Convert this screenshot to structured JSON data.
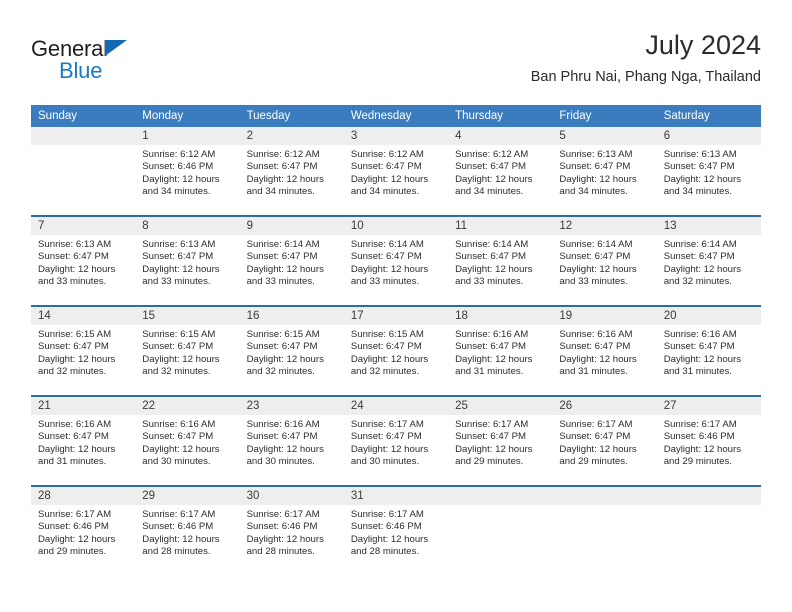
{
  "brand": {
    "name_part1": "General",
    "name_part2": "Blue",
    "triangle_color": "#1268b3",
    "blue_color": "#1b7ac4"
  },
  "header": {
    "title": "July 2024",
    "subtitle": "Ban Phru Nai, Phang Nga, Thailand"
  },
  "theme": {
    "header_bar_color": "#3a7cbe",
    "row_divider_color": "#2e6da4",
    "daynum_strip_color": "#eeeeee"
  },
  "weekdays": [
    "Sunday",
    "Monday",
    "Tuesday",
    "Wednesday",
    "Thursday",
    "Friday",
    "Saturday"
  ],
  "labels": {
    "sunrise_prefix": "Sunrise: ",
    "sunset_prefix": "Sunset: ",
    "daylight_prefix": "Daylight: "
  },
  "weeks": [
    [
      {
        "day": "",
        "sunrise": "",
        "sunset": "",
        "daylight_l1": "",
        "daylight_l2": ""
      },
      {
        "day": "1",
        "sunrise": "Sunrise: 6:12 AM",
        "sunset": "Sunset: 6:46 PM",
        "daylight_l1": "Daylight: 12 hours",
        "daylight_l2": "and 34 minutes."
      },
      {
        "day": "2",
        "sunrise": "Sunrise: 6:12 AM",
        "sunset": "Sunset: 6:47 PM",
        "daylight_l1": "Daylight: 12 hours",
        "daylight_l2": "and 34 minutes."
      },
      {
        "day": "3",
        "sunrise": "Sunrise: 6:12 AM",
        "sunset": "Sunset: 6:47 PM",
        "daylight_l1": "Daylight: 12 hours",
        "daylight_l2": "and 34 minutes."
      },
      {
        "day": "4",
        "sunrise": "Sunrise: 6:12 AM",
        "sunset": "Sunset: 6:47 PM",
        "daylight_l1": "Daylight: 12 hours",
        "daylight_l2": "and 34 minutes."
      },
      {
        "day": "5",
        "sunrise": "Sunrise: 6:13 AM",
        "sunset": "Sunset: 6:47 PM",
        "daylight_l1": "Daylight: 12 hours",
        "daylight_l2": "and 34 minutes."
      },
      {
        "day": "6",
        "sunrise": "Sunrise: 6:13 AM",
        "sunset": "Sunset: 6:47 PM",
        "daylight_l1": "Daylight: 12 hours",
        "daylight_l2": "and 34 minutes."
      }
    ],
    [
      {
        "day": "7",
        "sunrise": "Sunrise: 6:13 AM",
        "sunset": "Sunset: 6:47 PM",
        "daylight_l1": "Daylight: 12 hours",
        "daylight_l2": "and 33 minutes."
      },
      {
        "day": "8",
        "sunrise": "Sunrise: 6:13 AM",
        "sunset": "Sunset: 6:47 PM",
        "daylight_l1": "Daylight: 12 hours",
        "daylight_l2": "and 33 minutes."
      },
      {
        "day": "9",
        "sunrise": "Sunrise: 6:14 AM",
        "sunset": "Sunset: 6:47 PM",
        "daylight_l1": "Daylight: 12 hours",
        "daylight_l2": "and 33 minutes."
      },
      {
        "day": "10",
        "sunrise": "Sunrise: 6:14 AM",
        "sunset": "Sunset: 6:47 PM",
        "daylight_l1": "Daylight: 12 hours",
        "daylight_l2": "and 33 minutes."
      },
      {
        "day": "11",
        "sunrise": "Sunrise: 6:14 AM",
        "sunset": "Sunset: 6:47 PM",
        "daylight_l1": "Daylight: 12 hours",
        "daylight_l2": "and 33 minutes."
      },
      {
        "day": "12",
        "sunrise": "Sunrise: 6:14 AM",
        "sunset": "Sunset: 6:47 PM",
        "daylight_l1": "Daylight: 12 hours",
        "daylight_l2": "and 33 minutes."
      },
      {
        "day": "13",
        "sunrise": "Sunrise: 6:14 AM",
        "sunset": "Sunset: 6:47 PM",
        "daylight_l1": "Daylight: 12 hours",
        "daylight_l2": "and 32 minutes."
      }
    ],
    [
      {
        "day": "14",
        "sunrise": "Sunrise: 6:15 AM",
        "sunset": "Sunset: 6:47 PM",
        "daylight_l1": "Daylight: 12 hours",
        "daylight_l2": "and 32 minutes."
      },
      {
        "day": "15",
        "sunrise": "Sunrise: 6:15 AM",
        "sunset": "Sunset: 6:47 PM",
        "daylight_l1": "Daylight: 12 hours",
        "daylight_l2": "and 32 minutes."
      },
      {
        "day": "16",
        "sunrise": "Sunrise: 6:15 AM",
        "sunset": "Sunset: 6:47 PM",
        "daylight_l1": "Daylight: 12 hours",
        "daylight_l2": "and 32 minutes."
      },
      {
        "day": "17",
        "sunrise": "Sunrise: 6:15 AM",
        "sunset": "Sunset: 6:47 PM",
        "daylight_l1": "Daylight: 12 hours",
        "daylight_l2": "and 32 minutes."
      },
      {
        "day": "18",
        "sunrise": "Sunrise: 6:16 AM",
        "sunset": "Sunset: 6:47 PM",
        "daylight_l1": "Daylight: 12 hours",
        "daylight_l2": "and 31 minutes."
      },
      {
        "day": "19",
        "sunrise": "Sunrise: 6:16 AM",
        "sunset": "Sunset: 6:47 PM",
        "daylight_l1": "Daylight: 12 hours",
        "daylight_l2": "and 31 minutes."
      },
      {
        "day": "20",
        "sunrise": "Sunrise: 6:16 AM",
        "sunset": "Sunset: 6:47 PM",
        "daylight_l1": "Daylight: 12 hours",
        "daylight_l2": "and 31 minutes."
      }
    ],
    [
      {
        "day": "21",
        "sunrise": "Sunrise: 6:16 AM",
        "sunset": "Sunset: 6:47 PM",
        "daylight_l1": "Daylight: 12 hours",
        "daylight_l2": "and 31 minutes."
      },
      {
        "day": "22",
        "sunrise": "Sunrise: 6:16 AM",
        "sunset": "Sunset: 6:47 PM",
        "daylight_l1": "Daylight: 12 hours",
        "daylight_l2": "and 30 minutes."
      },
      {
        "day": "23",
        "sunrise": "Sunrise: 6:16 AM",
        "sunset": "Sunset: 6:47 PM",
        "daylight_l1": "Daylight: 12 hours",
        "daylight_l2": "and 30 minutes."
      },
      {
        "day": "24",
        "sunrise": "Sunrise: 6:17 AM",
        "sunset": "Sunset: 6:47 PM",
        "daylight_l1": "Daylight: 12 hours",
        "daylight_l2": "and 30 minutes."
      },
      {
        "day": "25",
        "sunrise": "Sunrise: 6:17 AM",
        "sunset": "Sunset: 6:47 PM",
        "daylight_l1": "Daylight: 12 hours",
        "daylight_l2": "and 29 minutes."
      },
      {
        "day": "26",
        "sunrise": "Sunrise: 6:17 AM",
        "sunset": "Sunset: 6:47 PM",
        "daylight_l1": "Daylight: 12 hours",
        "daylight_l2": "and 29 minutes."
      },
      {
        "day": "27",
        "sunrise": "Sunrise: 6:17 AM",
        "sunset": "Sunset: 6:46 PM",
        "daylight_l1": "Daylight: 12 hours",
        "daylight_l2": "and 29 minutes."
      }
    ],
    [
      {
        "day": "28",
        "sunrise": "Sunrise: 6:17 AM",
        "sunset": "Sunset: 6:46 PM",
        "daylight_l1": "Daylight: 12 hours",
        "daylight_l2": "and 29 minutes."
      },
      {
        "day": "29",
        "sunrise": "Sunrise: 6:17 AM",
        "sunset": "Sunset: 6:46 PM",
        "daylight_l1": "Daylight: 12 hours",
        "daylight_l2": "and 28 minutes."
      },
      {
        "day": "30",
        "sunrise": "Sunrise: 6:17 AM",
        "sunset": "Sunset: 6:46 PM",
        "daylight_l1": "Daylight: 12 hours",
        "daylight_l2": "and 28 minutes."
      },
      {
        "day": "31",
        "sunrise": "Sunrise: 6:17 AM",
        "sunset": "Sunset: 6:46 PM",
        "daylight_l1": "Daylight: 12 hours",
        "daylight_l2": "and 28 minutes."
      },
      {
        "day": "",
        "sunrise": "",
        "sunset": "",
        "daylight_l1": "",
        "daylight_l2": ""
      },
      {
        "day": "",
        "sunrise": "",
        "sunset": "",
        "daylight_l1": "",
        "daylight_l2": ""
      },
      {
        "day": "",
        "sunrise": "",
        "sunset": "",
        "daylight_l1": "",
        "daylight_l2": ""
      }
    ]
  ]
}
